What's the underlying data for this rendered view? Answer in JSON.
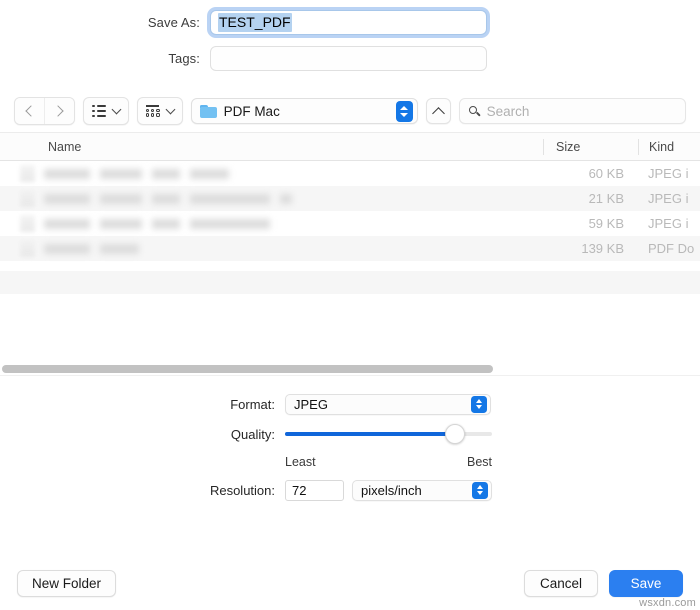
{
  "save_as": {
    "label": "Save As:",
    "value": "TEST_PDF",
    "selected": true
  },
  "tags": {
    "label": "Tags:",
    "value": "",
    "placeholder": ""
  },
  "toolbar": {
    "back_icon": "chevron-left-icon",
    "forward_icon": "chevron-right-icon",
    "list_view_icon": "list-view-icon",
    "grid_view_icon": "grid-view-icon",
    "path_label": "PDF Mac",
    "folder_icon": "folder-icon",
    "up_icon": "chevron-up-icon",
    "search_placeholder": "Search",
    "search_value": "",
    "search_icon": "search-icon"
  },
  "file_list": {
    "columns": {
      "name": "Name",
      "size": "Size",
      "kind": "Kind"
    },
    "rows": [
      {
        "name": "",
        "size": "60 KB",
        "kind": "JPEG i"
      },
      {
        "name": "",
        "size": "21 KB",
        "kind": "JPEG i"
      },
      {
        "name": "",
        "size": "59 KB",
        "kind": "JPEG i"
      },
      {
        "name": "",
        "size": "139 KB",
        "kind": "PDF Do"
      }
    ]
  },
  "options": {
    "format": {
      "label": "Format:",
      "value": "JPEG"
    },
    "quality": {
      "label": "Quality:",
      "value": 82,
      "min_label": "Least",
      "max_label": "Best"
    },
    "resolution": {
      "label": "Resolution:",
      "value": "72",
      "unit": "pixels/inch"
    }
  },
  "buttons": {
    "new_folder": "New Folder",
    "cancel": "Cancel",
    "save": "Save"
  },
  "watermark": "wsxdn.com",
  "colors": {
    "accent": "#2b7ff0",
    "stepper_blue": "#1477e6",
    "slider_blue": "#1066da",
    "selection": "#b4d2f0",
    "folder": "#73c1f2"
  }
}
